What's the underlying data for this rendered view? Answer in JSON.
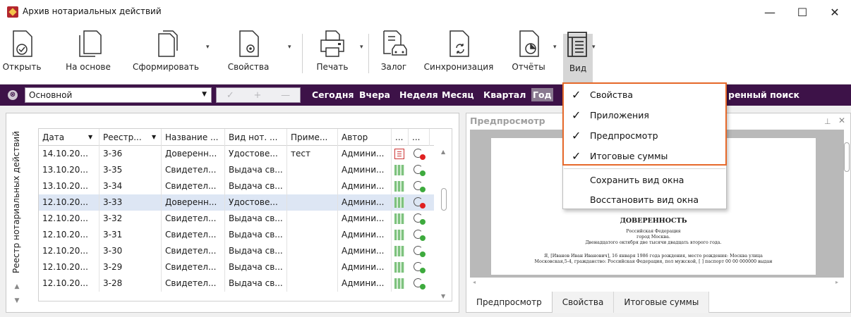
{
  "window": {
    "title": "Архив нотариальных действий",
    "minimize": "—",
    "maximize": "☐",
    "close": "✕"
  },
  "ribbon": {
    "buttons": [
      {
        "label": "Открыть",
        "icon": "open-doc-icon"
      },
      {
        "label": "На основе",
        "icon": "copy-doc-icon"
      },
      {
        "label": "Сформировать",
        "icon": "generate-doc-icon"
      },
      {
        "label": "Свойства",
        "icon": "properties-doc-icon"
      },
      {
        "label": "Печать",
        "icon": "printer-icon"
      },
      {
        "label": "Залог",
        "icon": "pledge-car-icon"
      },
      {
        "label": "Синхронизация",
        "icon": "sync-doc-icon"
      },
      {
        "label": "Отчёты",
        "icon": "report-chart-icon"
      },
      {
        "label": "Вид",
        "icon": "view-layout-icon"
      }
    ]
  },
  "filterbar": {
    "clear": "⊗",
    "combo_value": "Основной",
    "mini": [
      "✓",
      "+",
      "—"
    ],
    "periods": [
      "Сегодня",
      "Вчера",
      "Неделя",
      "Месяц",
      "Квартал",
      "Год"
    ],
    "extended_search": "ренный поиск"
  },
  "left_panel": {
    "vertical_tab": "Реестр нотариальных действий"
  },
  "grid": {
    "columns": [
      "Дата",
      "Реестр...",
      "Название ...",
      "Вид нот. ...",
      "Приме...",
      "Автор",
      "...",
      "..."
    ],
    "rows": [
      {
        "date": "14.10.20...",
        "reg": "3-36",
        "name": "Доверенн...",
        "kind": "Удостове...",
        "note": "тест",
        "author": "Админи...",
        "status": "doc",
        "sync": "red"
      },
      {
        "date": "13.10.20...",
        "reg": "3-35",
        "name": "Свидетел...",
        "kind": "Выдача св...",
        "note": "",
        "author": "Админи...",
        "status": "qr",
        "sync": "green"
      },
      {
        "date": "13.10.20...",
        "reg": "3-34",
        "name": "Свидетел...",
        "kind": "Выдача св...",
        "note": "",
        "author": "Админи...",
        "status": "qr",
        "sync": "green"
      },
      {
        "date": "12.10.20...",
        "reg": "3-33",
        "name": "Доверенн...",
        "kind": "Удостове...",
        "note": "",
        "author": "Админи...",
        "status": "qr",
        "sync": "red"
      },
      {
        "date": "12.10.20...",
        "reg": "3-32",
        "name": "Свидетел...",
        "kind": "Выдача св...",
        "note": "",
        "author": "Админи...",
        "status": "qr",
        "sync": "green"
      },
      {
        "date": "12.10.20...",
        "reg": "3-31",
        "name": "Свидетел...",
        "kind": "Выдача св...",
        "note": "",
        "author": "Админи...",
        "status": "qr",
        "sync": "green"
      },
      {
        "date": "12.10.20...",
        "reg": "3-30",
        "name": "Свидетел...",
        "kind": "Выдача св...",
        "note": "",
        "author": "Админи...",
        "status": "qr",
        "sync": "green"
      },
      {
        "date": "12.10.20...",
        "reg": "3-29",
        "name": "Свидетел...",
        "kind": "Выдача св...",
        "note": "",
        "author": "Админи...",
        "status": "qr",
        "sync": "green"
      },
      {
        "date": "12.10.20...",
        "reg": "3-28",
        "name": "Свидетел...",
        "kind": "Выдача св...",
        "note": "",
        "author": "Админи...",
        "status": "qr",
        "sync": "green"
      }
    ],
    "selected_row": 3
  },
  "preview": {
    "header": "Предпросмотр",
    "doc": {
      "title": "ДОВЕРЕННОСТЬ",
      "lines": [
        "Российская Федерация",
        "город Москва.",
        "Двенадцатого октября две тысячи двадцать второго года.",
        "Я, [Иванов Иван Иванович], 16 января 1986 года рождения, место рождения: Москва улица",
        "Московская,5-4, гражданство: Российская Федерация, пол мужской, [ ] паспорт 00 00 000000 выдан"
      ]
    },
    "tabs": [
      "Предпросмотр",
      "Свойства",
      "Итоговые суммы"
    ]
  },
  "view_menu": {
    "items": [
      {
        "label": "Свойства",
        "checked": "✓"
      },
      {
        "label": "Приложения",
        "checked": "✓"
      },
      {
        "label": "Предпросмотр",
        "checked": "✓"
      },
      {
        "label": "Итоговые суммы",
        "checked": "✓"
      },
      {
        "label": "Сохранить вид окна",
        "checked": ""
      },
      {
        "label": "Восстановить вид окна",
        "checked": ""
      }
    ]
  },
  "colors": {
    "accent": "#3d1248",
    "highlight": "#e6692a",
    "selection": "#dde6f4",
    "status_red": "#e02020",
    "status_green": "#3daa3d"
  }
}
